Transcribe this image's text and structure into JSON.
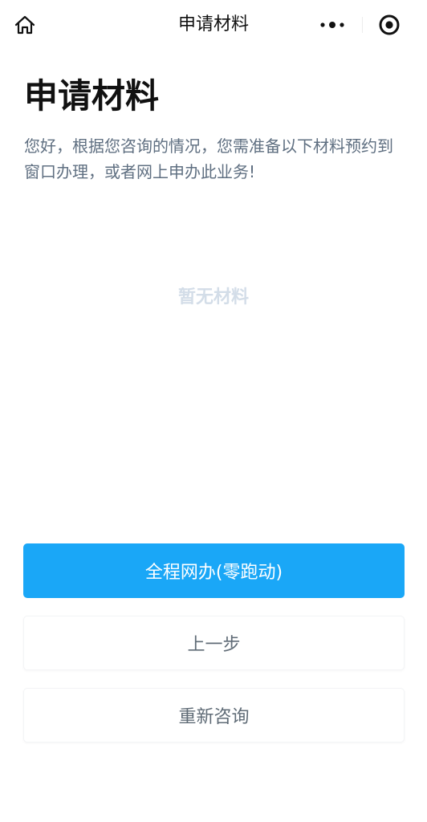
{
  "nav": {
    "title": "申请材料",
    "home_icon": "home-icon",
    "more_icon": "more-dots-icon",
    "close_icon": "target-close-icon"
  },
  "header": {
    "title": "申请材料",
    "intro": "您好，根据您咨询的情况，您需准备以下材料预约到窗口办理，或者网上申办此业务!"
  },
  "materials": {
    "empty_text": "暂无材料"
  },
  "actions": {
    "online_label": "全程网办(零跑动)",
    "prev_label": "上一步",
    "reconsult_label": "重新咨询"
  },
  "colors": {
    "primary": "#1aa7f7",
    "intro_text": "#5f6f81",
    "empty_text": "#d3dde8"
  }
}
